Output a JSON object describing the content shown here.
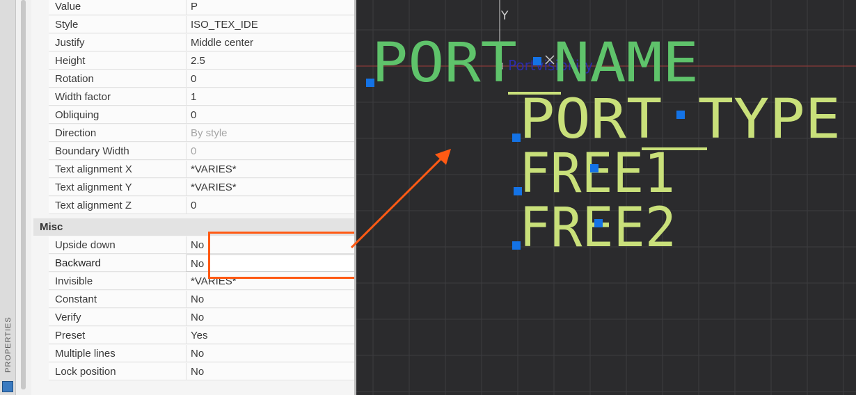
{
  "sidebar": {
    "label": "PROPERTIES",
    "icon": "properties-icon"
  },
  "properties_top": [
    {
      "key": "Value",
      "value": "P"
    },
    {
      "key": "Style",
      "value": "ISO_TEX_IDE"
    },
    {
      "key": "Justify",
      "value": "Middle center"
    },
    {
      "key": "Height",
      "value": "2.5"
    },
    {
      "key": "Rotation",
      "value": "0"
    },
    {
      "key": "Width factor",
      "value": "1"
    },
    {
      "key": "Obliquing",
      "value": "0"
    },
    {
      "key": "Direction",
      "value": "By style",
      "dim": true
    },
    {
      "key": "Boundary Width",
      "value": "0",
      "dim": true
    },
    {
      "key": "Text alignment X",
      "value": "*VARIES*"
    },
    {
      "key": "Text alignment Y",
      "value": "*VARIES*"
    },
    {
      "key": "Text alignment Z",
      "value": "0"
    }
  ],
  "misc": {
    "title": "Misc",
    "rows": [
      {
        "key": "Upside down",
        "value": "No"
      },
      {
        "key": "Backward",
        "value": "No",
        "active": true
      },
      {
        "key": "Invisible",
        "value": "*VARIES*"
      },
      {
        "key": "Constant",
        "value": "No"
      },
      {
        "key": "Verify",
        "value": "No"
      },
      {
        "key": "Preset",
        "value": "Yes"
      },
      {
        "key": "Multiple lines",
        "value": "No"
      },
      {
        "key": "Lock position",
        "value": "No"
      }
    ]
  },
  "canvas": {
    "axis_label": "Y",
    "small_label": "Portvisibility",
    "texts": [
      "PORT NAME",
      "PORT TYPE",
      "FREE1",
      "FREE2"
    ],
    "colors": {
      "background": "#2b2b2d",
      "grid": "#3c3c40",
      "text_green": "#5fc36b",
      "text_yellow": "#c9e07a",
      "grip": "#1473e6",
      "highlight": "#ff5a14",
      "axis_x": "#a03c3c",
      "axis_y": "#cfcfcf"
    }
  }
}
